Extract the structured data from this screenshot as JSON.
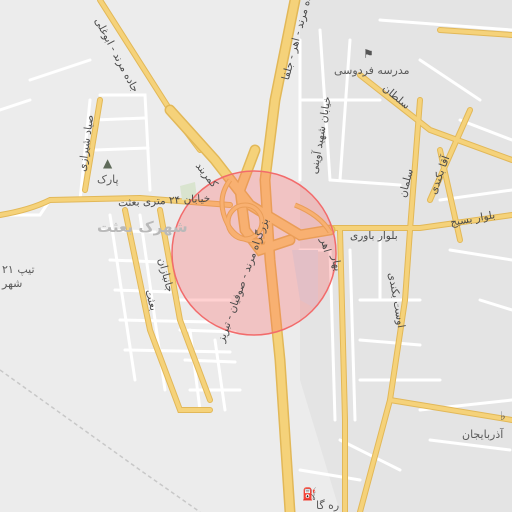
{
  "map": {
    "highlight_color": "#ff5a5a",
    "road_color": "#f5d27a",
    "road_edge_color": "#e2b858",
    "minor_road_color": "#ffffff",
    "labels": {
      "road_halghe_marand_ahar": "جاده مرند - اهر - جلفا",
      "road_halghe_marand_avoghli": "جاده مرند - ابوغلی",
      "road_kamarband": "کمربند",
      "road_khiaban_24_metri": "خیابان ۲۴ متری بعثت",
      "road_bolvar_bavari": "بلوار باوری",
      "road_bolvar_basij": "بلوار بسیج",
      "road_bozorgrah": "بزرگراه مرند - صوفیان - تبریز",
      "road_sayad_shirazi": "صیاد شیرازی",
      "road_shahid_avini": "خیابان شهید آوینی",
      "road_soltan": "سلطان",
      "road_agha_bekandi": "آقا بکندی",
      "road_ostad_baghdadi": "اوست بکندی",
      "road_ahar": "اهر",
      "road_bijar": "بهار",
      "road_besat_small": "بعثت",
      "road_janbazan": "جانبازان",
      "road_salman": "سلمان",
      "hood_besat": "شهرک بعثت",
      "poi_park": "پارک",
      "poi_school": "مدرسه فردوسی",
      "poi_azerbaijan": "آذربایجان",
      "poi_tip": "تیپ ۲۱",
      "poi_shahr": "شهر",
      "poi_bottom": "ره گا"
    },
    "icons": {
      "park": "tree-icon",
      "school": "school-icon",
      "restaurant": "restaurant-icon",
      "fuel": "fuel-icon"
    }
  }
}
